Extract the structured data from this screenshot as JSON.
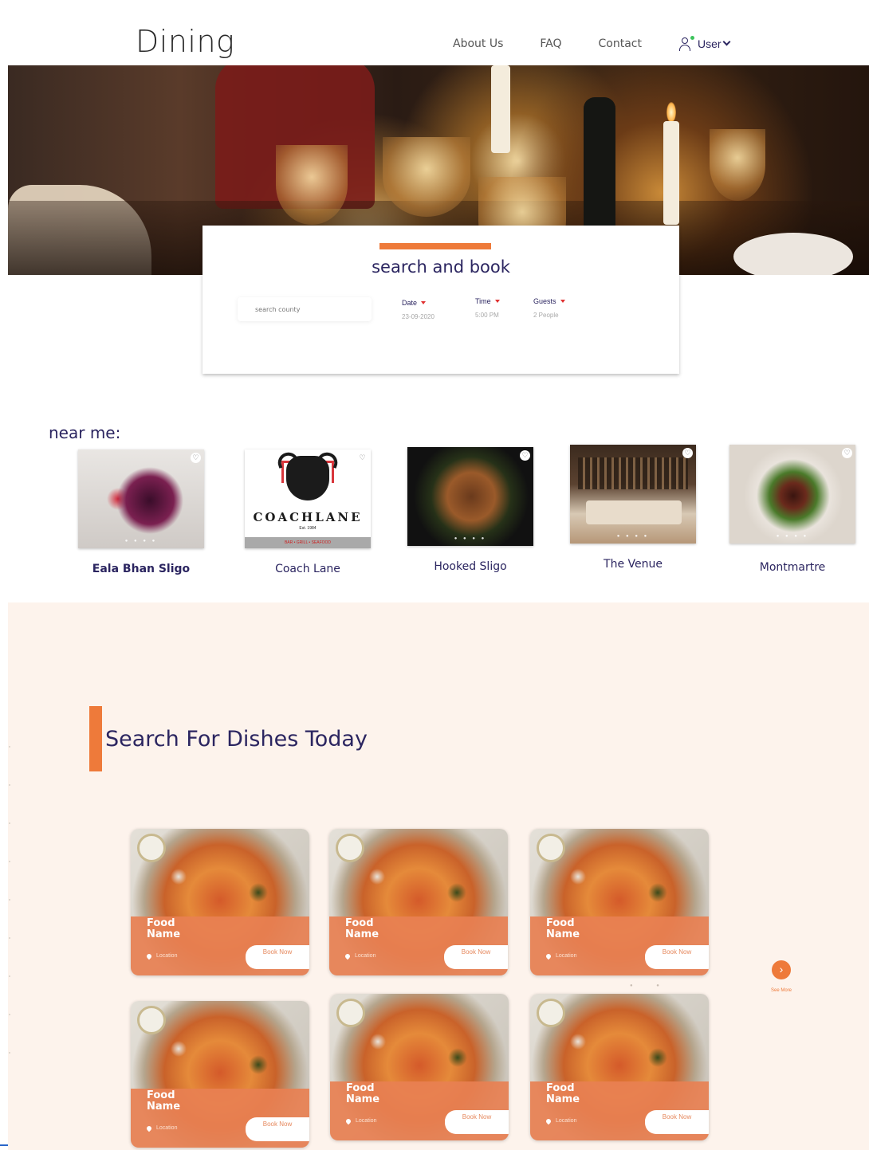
{
  "header": {
    "logo": "Dining",
    "nav": [
      "About Us",
      "FAQ",
      "Contact"
    ],
    "user_label": "User"
  },
  "search": {
    "title": "search and book",
    "placeholder": "search county",
    "date_label": "Date",
    "date_value": "23-09-2020",
    "time_label": "Time",
    "time_value": "5:00 PM",
    "guests_label": "Guests",
    "guests_value": "2 People"
  },
  "near_me": {
    "title": "near me:",
    "restaurants": [
      {
        "name": "Eala Bhan Sligo"
      },
      {
        "name": "Coach Lane",
        "logo_text": "COACHLANE",
        "logo_est": "Est. 1984",
        "logo_band": "BAR • GRILL • SEAFOOD"
      },
      {
        "name": "Hooked Sligo"
      },
      {
        "name": "The Venue"
      },
      {
        "name": "Montmartre"
      }
    ]
  },
  "dishes": {
    "title": "Search For Dishes Today",
    "cards": [
      {
        "name": "Food Name",
        "location": "Location",
        "button": "Book Now"
      },
      {
        "name": "Food Name",
        "location": "Location",
        "button": "Book Now"
      },
      {
        "name": "Food Name",
        "location": "Location",
        "button": "Book Now"
      },
      {
        "name": "Food Name",
        "location": "Location",
        "button": "Book Now"
      },
      {
        "name": "Food Name",
        "location": "Location",
        "button": "Book Now"
      },
      {
        "name": "Food Name",
        "location": "Location",
        "button": "Book Now"
      }
    ],
    "see_more": "See More",
    "next_icon": "chevron-right-icon"
  },
  "colors": {
    "brand_navy": "#2b2560",
    "accent_orange": "#ee7a3a",
    "section_bg": "#fdf3ec"
  }
}
